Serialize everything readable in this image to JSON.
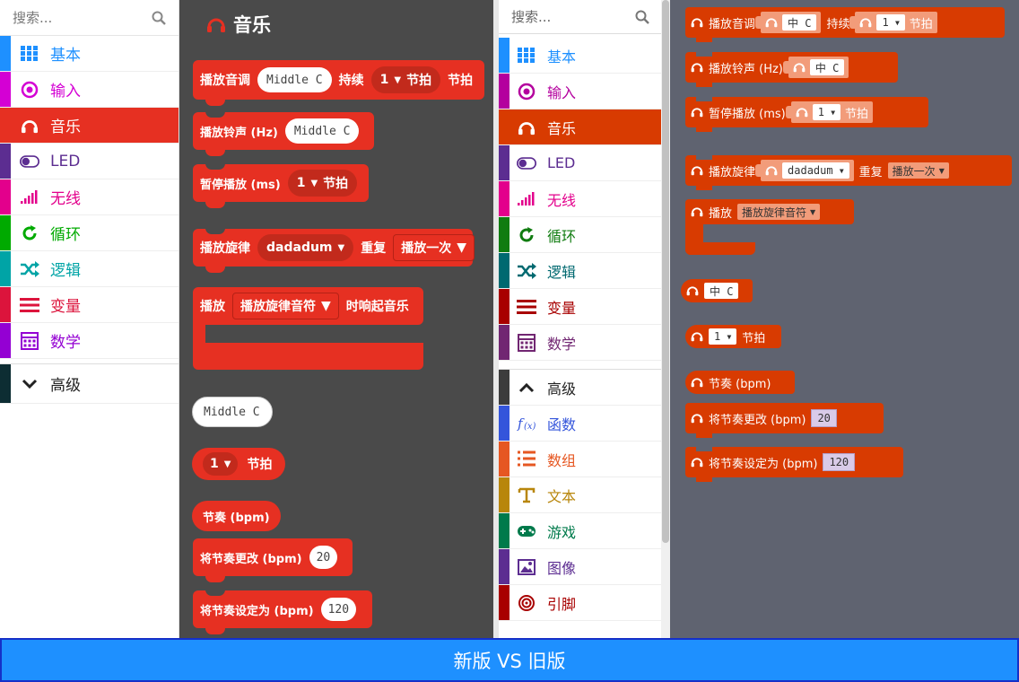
{
  "left": {
    "search_placeholder": "搜索...",
    "categories": [
      {
        "label": "基本",
        "color": "#1e90ff",
        "icon": "grid-icon"
      },
      {
        "label": "输入",
        "color": "#d400d4",
        "icon": "radio-target-icon"
      },
      {
        "label": "音乐",
        "color": "#e63022",
        "icon": "headphones-icon"
      },
      {
        "label": "LED",
        "color": "#5c2d91",
        "icon": "toggle-icon"
      },
      {
        "label": "无线",
        "color": "#e3008c",
        "icon": "signal-bars-icon"
      },
      {
        "label": "循环",
        "color": "#00aa00",
        "icon": "refresh-icon"
      },
      {
        "label": "逻辑",
        "color": "#00a4a6",
        "icon": "shuffle-icon"
      },
      {
        "label": "变量",
        "color": "#dc143c",
        "icon": "list-lines-icon"
      },
      {
        "label": "数学",
        "color": "#9400d3",
        "icon": "calculator-icon"
      }
    ],
    "advanced": "高级",
    "flyout_title": "音乐",
    "blocks": {
      "play_tone": {
        "a": "播放音调",
        "note": "Middle C",
        "b": "持续",
        "beat": "1",
        "beat_unit": "节拍",
        "c": "节拍"
      },
      "ring_tone": {
        "a": "播放铃声 (Hz)",
        "note": "Middle C"
      },
      "rest": {
        "a": "暂停播放 (ms)",
        "beat": "1",
        "beat_unit": "节拍"
      },
      "start_melody": {
        "a": "播放旋律",
        "melody": "dadadum",
        "b": "重复",
        "repeat": "播放一次"
      },
      "on_event": {
        "a": "播放",
        "event": "播放旋律音符",
        "b": "时响起音乐"
      },
      "note_value": "Middle C",
      "beat_value": {
        "beat": "1",
        "unit": "节拍"
      },
      "tempo": "节奏 (bpm)",
      "change_tempo": {
        "a": "将节奏更改 (bpm)",
        "value": "20"
      },
      "set_tempo": {
        "a": "将节奏设定为 (bpm)",
        "value": "120"
      }
    }
  },
  "right": {
    "search_placeholder": "搜索...",
    "categories": [
      {
        "label": "基本",
        "color": "#1e90ff",
        "icon": "grid-icon"
      },
      {
        "label": "输入",
        "color": "#b4009e",
        "icon": "radio-target-icon"
      },
      {
        "label": "音乐",
        "color": "#d83b01",
        "icon": "headphones-icon"
      },
      {
        "label": "LED",
        "color": "#5c2d91",
        "icon": "toggle-icon"
      },
      {
        "label": "无线",
        "color": "#e3008c",
        "icon": "signal-bars-icon"
      },
      {
        "label": "循环",
        "color": "#107c10",
        "icon": "refresh-icon"
      },
      {
        "label": "逻辑",
        "color": "#006970",
        "icon": "shuffle-icon"
      },
      {
        "label": "变量",
        "color": "#a80000",
        "icon": "list-lines-icon"
      },
      {
        "label": "数学",
        "color": "#712672",
        "icon": "calculator-icon"
      }
    ],
    "advanced": "高级",
    "adv_categories": [
      {
        "label": "函数",
        "color": "#3455db",
        "icon": "function-icon"
      },
      {
        "label": "数组",
        "color": "#e65722",
        "icon": "array-icon"
      },
      {
        "label": "文本",
        "color": "#b8860b",
        "icon": "text-t-icon"
      },
      {
        "label": "游戏",
        "color": "#007a4b",
        "icon": "gamepad-icon"
      },
      {
        "label": "图像",
        "color": "#5c2d91",
        "icon": "image-icon"
      },
      {
        "label": "引脚",
        "color": "#a80000",
        "icon": "pin-target-icon"
      }
    ],
    "blocks": {
      "play_tone": {
        "a": "播放音调",
        "note": "中 C",
        "b": "持续",
        "beat": "1",
        "beat_unit": "节拍"
      },
      "ring_tone": {
        "a": "播放铃声 (Hz)",
        "note": "中 C"
      },
      "rest": {
        "a": "暂停播放 (ms)",
        "beat": "1",
        "beat_unit": "节拍"
      },
      "start_melody": {
        "a": "播放旋律",
        "melody": "dadadum",
        "b": "重复",
        "repeat": "播放一次"
      },
      "on_event": {
        "a": "播放",
        "event": "播放旋律音符"
      },
      "note_value": "中 C",
      "beat_value": {
        "beat": "1",
        "unit": "节拍"
      },
      "tempo": "节奏 (bpm)",
      "change_tempo": {
        "a": "将节奏更改 (bpm)",
        "value": "20"
      },
      "set_tempo": {
        "a": "将节奏设定为 (bpm)",
        "value": "120"
      }
    }
  },
  "footer": "新版 VS 旧版"
}
